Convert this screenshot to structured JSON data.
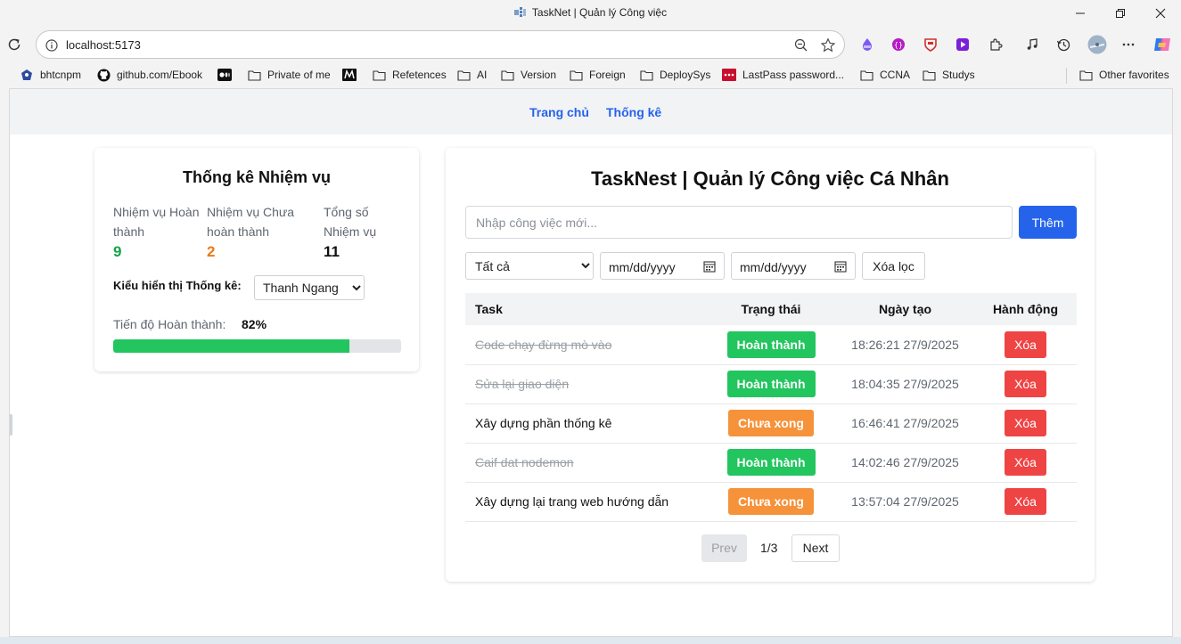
{
  "browser": {
    "window_title": "TaskNet | Quản lý Công việc",
    "url": "localhost:5173",
    "bookmarks": [
      {
        "label": "bhtcnpm"
      },
      {
        "label": "github.com/Ebook"
      },
      {
        "label": ""
      },
      {
        "label": "Private of me"
      },
      {
        "label": ""
      },
      {
        "label": "Refetences"
      },
      {
        "label": "AI"
      },
      {
        "label": "Version"
      },
      {
        "label": "Foreign"
      },
      {
        "label": "DeploySys"
      },
      {
        "label": "LastPass password..."
      },
      {
        "label": "CCNA"
      },
      {
        "label": "Studys"
      },
      {
        "label": "Other favorites"
      }
    ]
  },
  "nav": {
    "home": "Trang chủ",
    "stats": "Thống kê"
  },
  "stats_card": {
    "title": "Thống kê Nhiệm vụ",
    "completed_label_1": "Nhiệm vụ Hoàn",
    "completed_label_2": "thành",
    "completed_value": "9",
    "pending_label_1": "Nhiệm vụ Chưa",
    "pending_label_2": "hoàn thành",
    "pending_value": "2",
    "total_label_1": "Tổng số",
    "total_label_2": "Nhiệm vụ",
    "total_value": "11",
    "display_mode_label": "Kiểu hiển thị Thống kê:",
    "display_mode_value": "Thanh Ngang",
    "progress_label": "Tiến độ Hoàn thành:",
    "progress_text": "82%",
    "progress_fraction": 0.82,
    "colors": {
      "completed": "#16a34a",
      "pending": "#ea7a17",
      "bar": "#22c55e"
    }
  },
  "tasks_card": {
    "title": "TaskNest | Quản lý Công việc Cá Nhân",
    "input_placeholder": "Nhập công việc mới...",
    "add_button": "Thêm",
    "filter_value": "Tất cả",
    "date_from_placeholder": "mm/dd/yyyy",
    "date_to_placeholder": "mm/dd/yyyy",
    "clear_filter": "Xóa lọc",
    "columns": {
      "task": "Task",
      "status": "Trạng thái",
      "created": "Ngày tạo",
      "action": "Hành động"
    },
    "rows": [
      {
        "task": "Code chạy đừng mò vào",
        "status": "Hoàn thành",
        "created": "18:26:21 27/9/2025",
        "action": "Xóa"
      },
      {
        "task": "Sửa lại giao diện",
        "status": "Hoàn thành",
        "created": "18:04:35 27/9/2025",
        "action": "Xóa"
      },
      {
        "task": "Xây dựng phần thống kê",
        "status": "Chưa xong",
        "created": "16:46:41 27/9/2025",
        "action": "Xóa"
      },
      {
        "task": "Caif dat nodemon",
        "status": "Hoàn thành",
        "created": "14:02:46 27/9/2025",
        "action": "Xóa"
      },
      {
        "task": "Xây dựng lại trang web hướng dẫn",
        "status": "Chưa xong",
        "created": "13:57:04 27/9/2025",
        "action": "Xóa"
      }
    ],
    "pagination": {
      "prev": "Prev",
      "page": "1/3",
      "next": "Next"
    }
  }
}
